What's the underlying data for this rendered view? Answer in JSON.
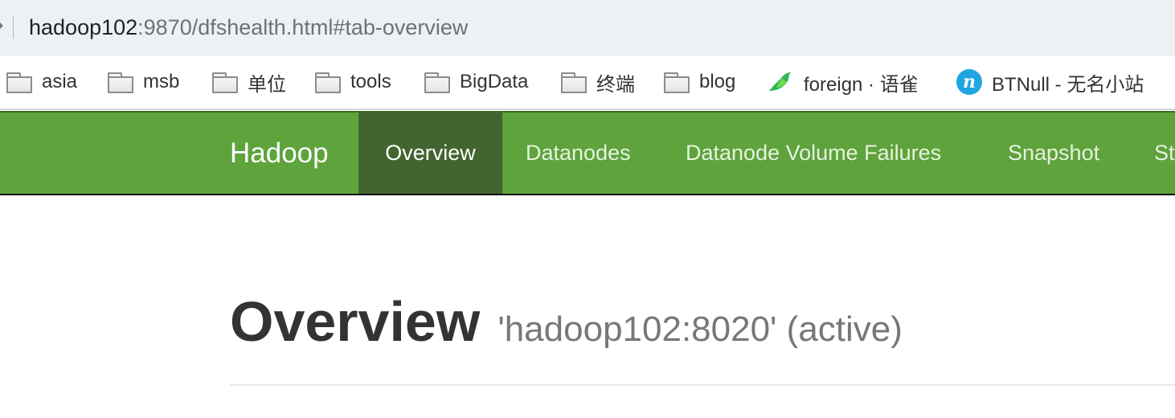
{
  "address_bar": {
    "host": "hadoop102",
    "rest": ":9870/dfshealth.html#tab-overview"
  },
  "bookmarks": [
    {
      "label": "asia",
      "icon": "folder-icon"
    },
    {
      "label": "msb",
      "icon": "folder-icon"
    },
    {
      "label": "单位",
      "icon": "folder-icon"
    },
    {
      "label": "tools",
      "icon": "folder-icon"
    },
    {
      "label": "BigData",
      "icon": "folder-icon"
    },
    {
      "label": "终端",
      "icon": "folder-icon"
    },
    {
      "label": "blog",
      "icon": "folder-icon"
    },
    {
      "label": "foreign · 语雀",
      "icon": "yuque-bird-icon"
    },
    {
      "label": "BTNull - 无名小站",
      "icon": "btnull-n-icon"
    }
  ],
  "nav": {
    "brand": "Hadoop",
    "items": [
      "Overview",
      "Datanodes",
      "Datanode Volume Failures",
      "Snapshot",
      "St"
    ],
    "active": "Overview"
  },
  "page": {
    "title": "Overview",
    "subtitle": "'hadoop102:8020' (active)"
  },
  "colors": {
    "nav_bg": "#5ea33c",
    "nav_active_bg": "#426530",
    "title": "#333333",
    "subtitle": "#777777"
  }
}
